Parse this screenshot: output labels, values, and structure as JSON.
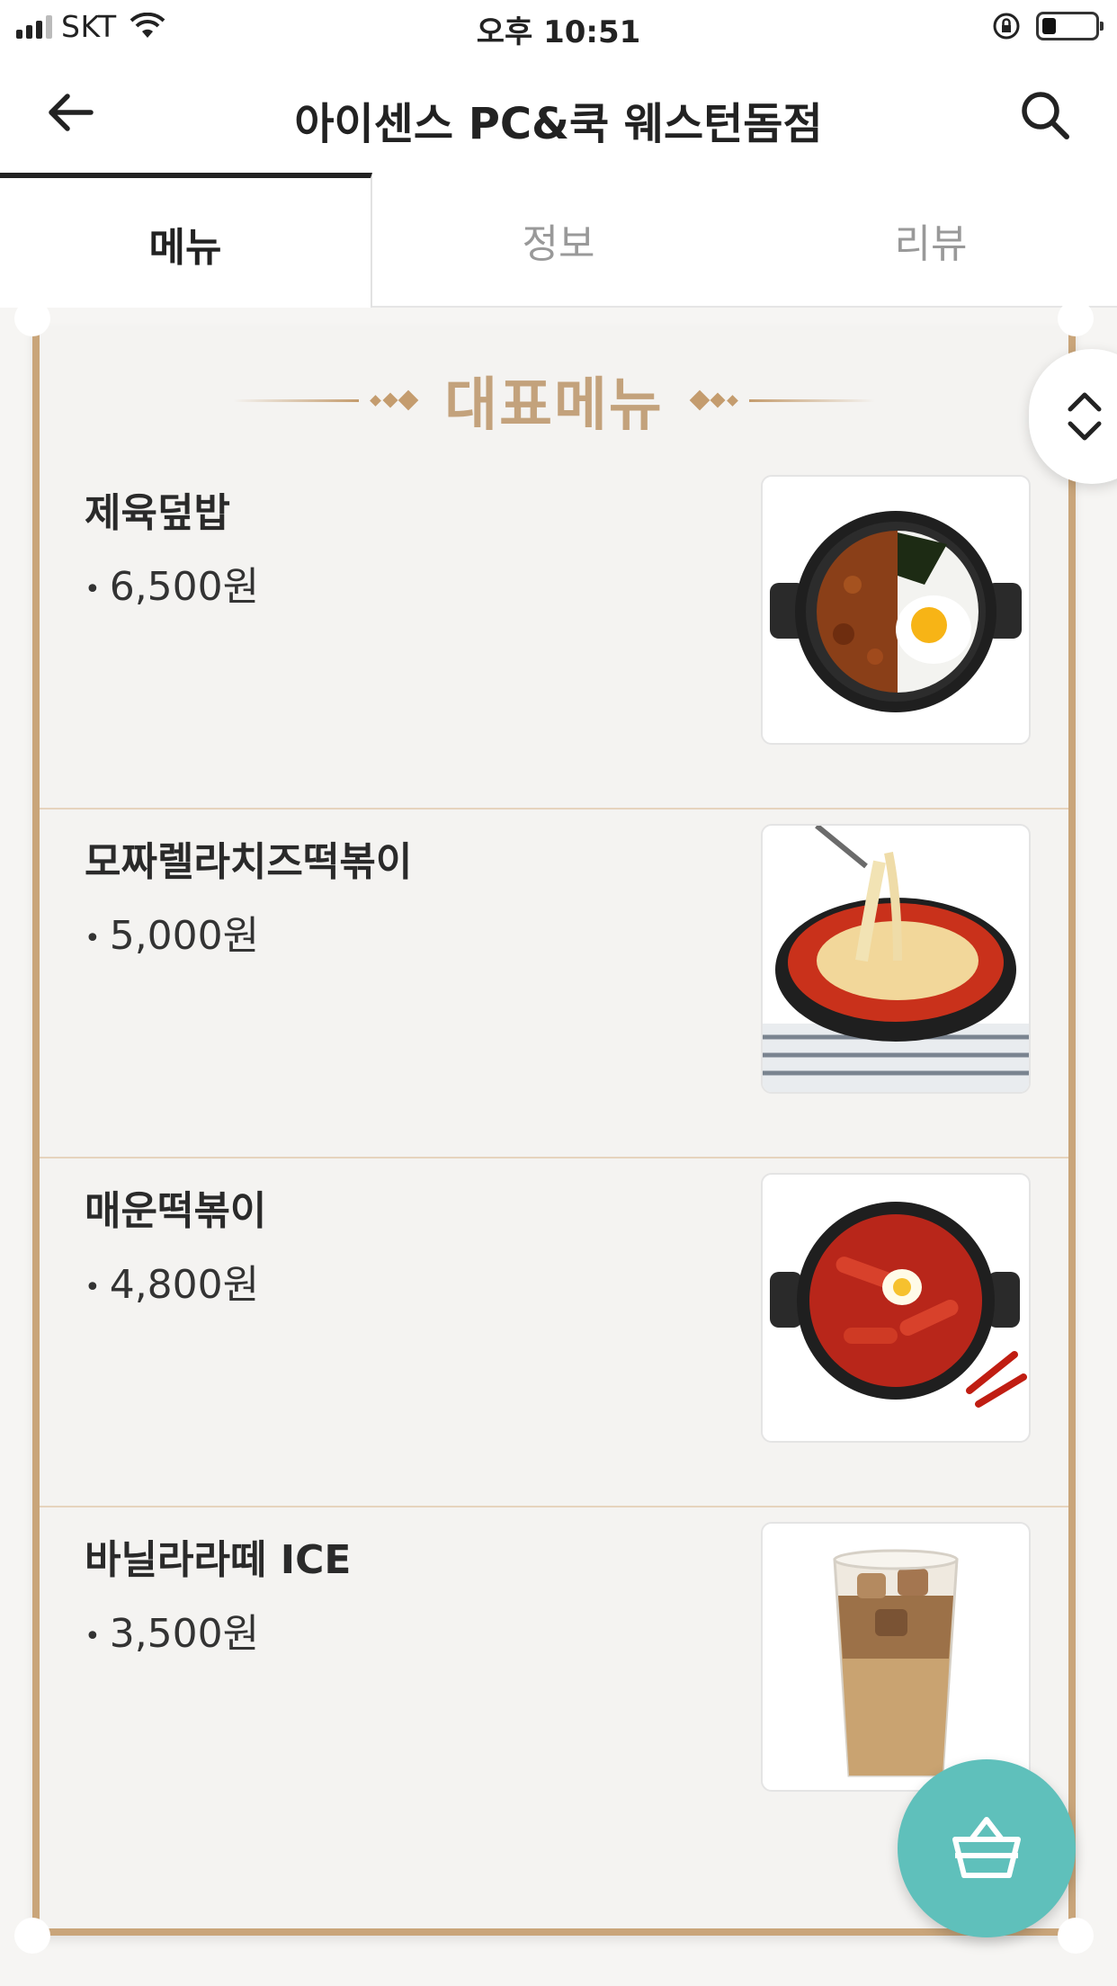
{
  "status_bar": {
    "carrier": "SKT",
    "time": "오후 10:51",
    "battery_level": 0.25
  },
  "header": {
    "title": "아이센스 PC&쿡 웨스턴돔점",
    "back_icon": "back-arrow-icon",
    "search_icon": "search-icon"
  },
  "tabs": [
    {
      "label": "메뉴",
      "active": true
    },
    {
      "label": "정보",
      "active": false
    },
    {
      "label": "리뷰",
      "active": false
    }
  ],
  "section": {
    "title": "대표메뉴"
  },
  "menu_items": [
    {
      "name": "제육덮밥",
      "price": "6,500원",
      "image": "jeyuk-rice-bowl-photo"
    },
    {
      "name": "모짜렐라치즈떡볶이",
      "price": "5,000원",
      "image": "mozzarella-tteokbokki-photo"
    },
    {
      "name": "매운떡볶이",
      "price": "4,800원",
      "image": "spicy-tteokbokki-photo"
    },
    {
      "name": "바닐라라떼 ICE",
      "price": "3,500원",
      "image": "iced-vanilla-latte-photo"
    }
  ],
  "floating": {
    "scroll_toggle_icon": "chevron-up-down-icon",
    "cart_icon": "basket-icon",
    "cart_color": "#5fc0bb"
  },
  "colors": {
    "accent_gold": "#c9a57a",
    "panel_bg": "#f4f3f1"
  }
}
